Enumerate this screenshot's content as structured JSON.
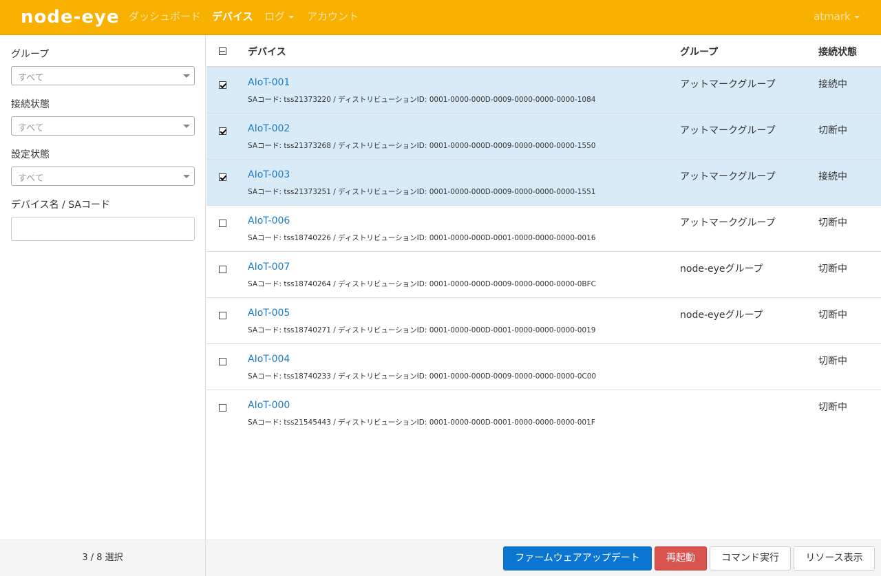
{
  "header": {
    "logo": "node-eye",
    "nav": [
      {
        "label": "ダッシュボード"
      },
      {
        "label": "デバイス"
      },
      {
        "label": "ログ"
      },
      {
        "label": "アカウント"
      }
    ],
    "user": "atmark"
  },
  "sidebar": {
    "group_label": "グループ",
    "group_value": "すべて",
    "connection_label": "接続状態",
    "connection_value": "すべて",
    "setting_label": "設定状態",
    "setting_value": "すべて",
    "name_label": "デバイス名 / SAコード",
    "name_value": ""
  },
  "table": {
    "col_device": "デバイス",
    "col_group": "グループ",
    "col_status": "接続状態",
    "rows": [
      {
        "name": "AIoT-001",
        "meta": "SAコード: tss21373220 / ディストリビューションID: 0001-0000-000D-0009-0000-0000-0000-1084",
        "group": "アットマークグループ",
        "status": "接続中",
        "checked": true
      },
      {
        "name": "AIoT-002",
        "meta": "SAコード: tss21373268 / ディストリビューションID: 0001-0000-000D-0009-0000-0000-0000-1550",
        "group": "アットマークグループ",
        "status": "切断中",
        "checked": true
      },
      {
        "name": "AIoT-003",
        "meta": "SAコード: tss21373251 / ディストリビューションID: 0001-0000-000D-0009-0000-0000-0000-1551",
        "group": "アットマークグループ",
        "status": "接続中",
        "checked": true
      },
      {
        "name": "AIoT-006",
        "meta": "SAコード: tss18740226 / ディストリビューションID: 0001-0000-000D-0001-0000-0000-0000-0016",
        "group": "アットマークグループ",
        "status": "切断中",
        "checked": false
      },
      {
        "name": "AIoT-007",
        "meta": "SAコード: tss18740264 / ディストリビューションID: 0001-0000-000D-0009-0000-0000-0000-0BFC",
        "group": "node-eyeグループ",
        "status": "切断中",
        "checked": false
      },
      {
        "name": "AIoT-005",
        "meta": "SAコード: tss18740271 / ディストリビューションID: 0001-0000-000D-0001-0000-0000-0000-0019",
        "group": "node-eyeグループ",
        "status": "切断中",
        "checked": false
      },
      {
        "name": "AIoT-004",
        "meta": "SAコード: tss18740233 / ディストリビューションID: 0001-0000-000D-0009-0000-0000-0000-0C00",
        "group": "",
        "status": "切断中",
        "checked": false
      },
      {
        "name": "AIoT-000",
        "meta": "SAコード: tss21545443 / ディストリビューションID: 0001-0000-000D-0001-0000-0000-0000-001F",
        "group": "",
        "status": "切断中",
        "checked": false
      }
    ]
  },
  "footer": {
    "selection": "3 / 8 選択",
    "firmware_button": "ファームウェアアップデート",
    "reboot_button": "再起動",
    "command_button": "コマンド実行",
    "resource_button": "リソース表示"
  },
  "colors": {
    "header_bg": "#f8b100",
    "selected_row_bg": "#d9ebf6",
    "link": "#1a7ac7",
    "primary": "#0b76d1",
    "danger": "#d9534f"
  }
}
